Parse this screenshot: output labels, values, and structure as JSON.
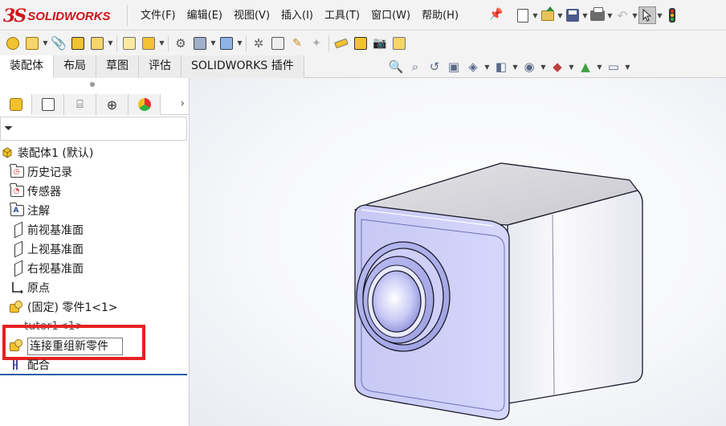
{
  "app": {
    "logo_mark": "3S",
    "logo_text": "SOLIDWORKS"
  },
  "menu": [
    {
      "label": "文件(F)",
      "name": "menu-file"
    },
    {
      "label": "编辑(E)",
      "name": "menu-edit"
    },
    {
      "label": "视图(V)",
      "name": "menu-view"
    },
    {
      "label": "插入(I)",
      "name": "menu-insert"
    },
    {
      "label": "工具(T)",
      "name": "menu-tools"
    },
    {
      "label": "窗口(W)",
      "name": "menu-window"
    },
    {
      "label": "帮助(H)",
      "name": "menu-help"
    }
  ],
  "tabs": [
    {
      "label": "装配体",
      "active": true
    },
    {
      "label": "布局",
      "active": false
    },
    {
      "label": "草图",
      "active": false
    },
    {
      "label": "评估",
      "active": false
    },
    {
      "label": "SOLIDWORKS 插件",
      "active": false
    }
  ],
  "tree": {
    "root": "装配体1 (默认)",
    "items": [
      {
        "label": "历史记录",
        "icon": "history-folder-icon"
      },
      {
        "label": "传感器",
        "icon": "sensor-folder-icon"
      },
      {
        "label": "注解",
        "icon": "annotation-folder-icon"
      },
      {
        "label": "前视基准面",
        "icon": "plane-icon"
      },
      {
        "label": "上视基准面",
        "icon": "plane-icon"
      },
      {
        "label": "右视基准面",
        "icon": "plane-icon"
      },
      {
        "label": "原点",
        "icon": "origin-icon"
      },
      {
        "label": "(固定) 零件1<1>",
        "icon": "part-icon"
      }
    ],
    "partial_item": "tutor1<1>",
    "mates": "配合"
  },
  "rename": {
    "value": "连接重组新零件"
  },
  "colors": {
    "highlight": "#e52222",
    "logo_red": "#d0121a",
    "model_face": "#e6e6f5",
    "model_edge": "#1a1a2a"
  }
}
